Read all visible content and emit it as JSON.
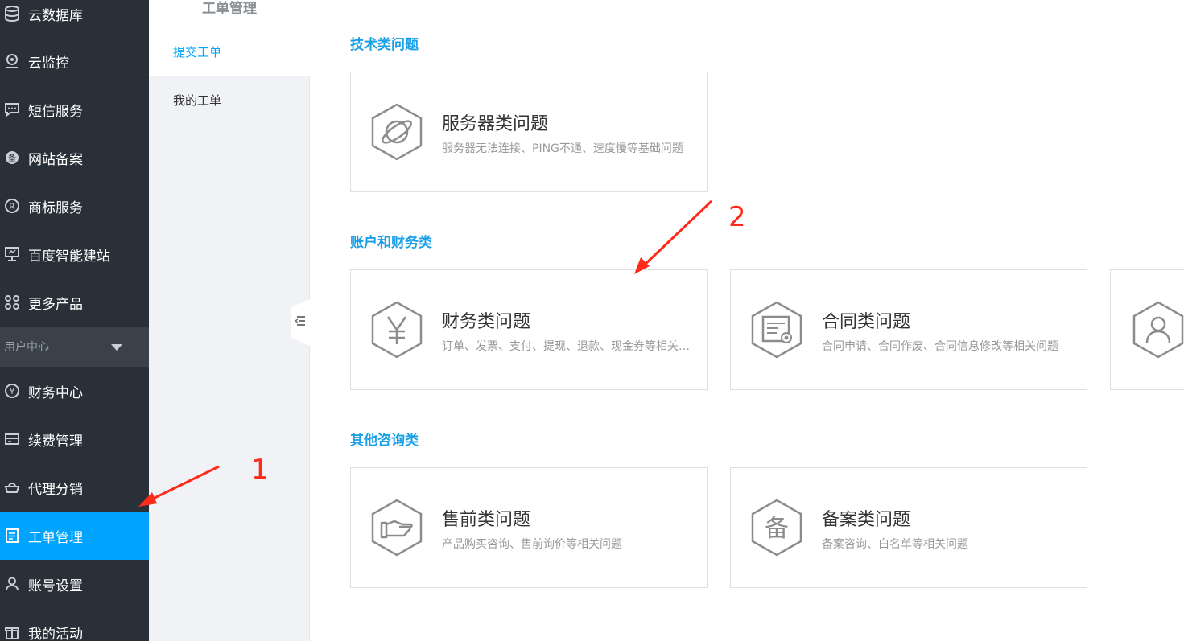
{
  "sidebar": {
    "items": [
      {
        "label": "云数据库",
        "icon": "database-icon"
      },
      {
        "label": "云监控",
        "icon": "monitor-camera-icon"
      },
      {
        "label": "短信服务",
        "icon": "message-icon"
      },
      {
        "label": "网站备案",
        "icon": "record-badge-icon"
      },
      {
        "label": "商标服务",
        "icon": "registered-trademark-icon"
      },
      {
        "label": "百度智能建站",
        "icon": "desktop-icon"
      },
      {
        "label": "更多产品",
        "icon": "grid-icon"
      }
    ],
    "section": {
      "label": "用户中心"
    },
    "user_items": [
      {
        "label": "财务中心",
        "icon": "yen-circle-icon"
      },
      {
        "label": "续费管理",
        "icon": "card-icon"
      },
      {
        "label": "代理分销",
        "icon": "basket-icon"
      },
      {
        "label": "工单管理",
        "icon": "ticket-icon"
      },
      {
        "label": "账号设置",
        "icon": "user-icon"
      },
      {
        "label": "我的活动",
        "icon": "gift-icon"
      }
    ]
  },
  "submenu": {
    "title": "工单管理",
    "items": [
      {
        "label": "提交工单"
      },
      {
        "label": "我的工单"
      }
    ]
  },
  "groups": [
    {
      "title": "技术类问题",
      "cards": [
        {
          "title": "服务器类问题",
          "desc": "服务器无法连接、PING不通、速度慢等基础问题",
          "icon": "planet-icon"
        }
      ]
    },
    {
      "title": "账户和财务类",
      "cards": [
        {
          "title": "财务类问题",
          "desc": "订单、发票、支付、提现、退款、现金券等相关问题",
          "icon": "yen-icon"
        },
        {
          "title": "合同类问题",
          "desc": "合同申请、合同作废、合同信息修改等相关问题",
          "icon": "contract-icon"
        },
        {
          "title": "",
          "desc": "",
          "icon": "user-icon"
        }
      ]
    },
    {
      "title": "其他咨询类",
      "cards": [
        {
          "title": "售前类问题",
          "desc": "产品购买咨询、售前询价等相关问题",
          "icon": "hand-icon"
        },
        {
          "title": "备案类问题",
          "desc": "备案咨询、白名单等相关问题",
          "icon": "bei-icon"
        }
      ]
    }
  ],
  "annotations": {
    "one": "1",
    "two": "2"
  },
  "colors": {
    "sidebar_bg": "#293038",
    "active": "#00a4ff",
    "group_title": "#1aa0e8",
    "annotation": "#ff2a1a"
  }
}
